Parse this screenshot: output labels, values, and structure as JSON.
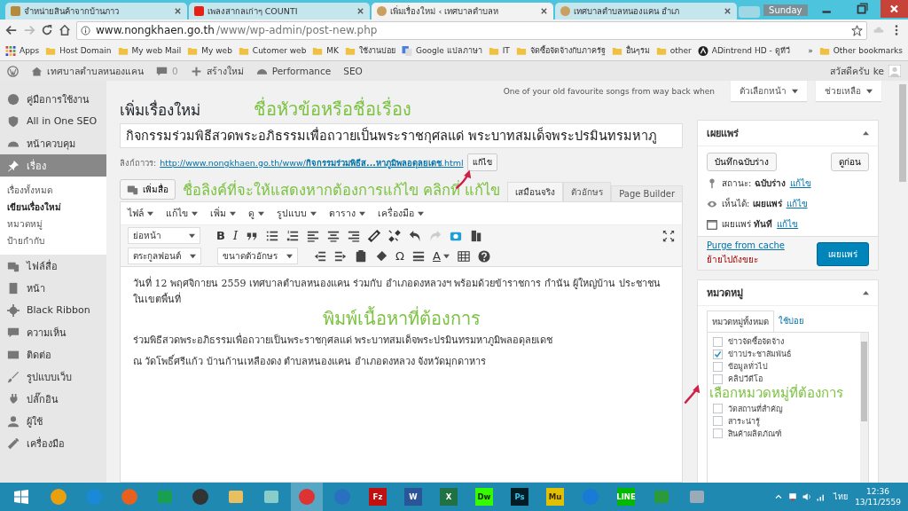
{
  "browser": {
    "tabs": [
      {
        "title": "จำหน่ายสินค้าจากบ้านภาว",
        "kind": "shop",
        "selected": false
      },
      {
        "title": "เพลงสากลเก่าๆ COUNTI",
        "kind": "video",
        "selected": false
      },
      {
        "title": "เพิ่มเรื่องใหม่ ‹ เทศบาลตำบลห",
        "kind": "site",
        "selected": true
      },
      {
        "title": "เทศบาลตำบลหนองแคน อำเภ",
        "kind": "site",
        "selected": false
      }
    ],
    "profile": "Sunday",
    "url_host": "www.nongkhaen.go.th",
    "url_path": "/www/wp-admin/post-new.php",
    "bookmarks": [
      {
        "label": "Apps",
        "kind": "apps"
      },
      {
        "label": "Host Domain",
        "kind": "folder"
      },
      {
        "label": "My web Mail",
        "kind": "folder"
      },
      {
        "label": "My web",
        "kind": "folder"
      },
      {
        "label": "Cutomer web",
        "kind": "folder"
      },
      {
        "label": "MK",
        "kind": "folder"
      },
      {
        "label": "ใช้งานบ่อย",
        "kind": "folder"
      },
      {
        "label": "Google แปลภาษา",
        "kind": "translate"
      },
      {
        "label": "IT",
        "kind": "folder"
      },
      {
        "label": "จัดซื้อจัดจ้างกับภาครัฐ",
        "kind": "folder"
      },
      {
        "label": "อื่นๆรม",
        "kind": "folder"
      },
      {
        "label": "other",
        "kind": "folder"
      },
      {
        "label": "ADintrend HD - ดูทีวี",
        "kind": "circle"
      }
    ],
    "more": "»",
    "other_bookmarks": "Other bookmarks"
  },
  "admin_bar": {
    "site": "เทศบาลตำบลหนองแคน",
    "comments": "0",
    "new": "สร้างใหม่",
    "items": [
      "Performance",
      "SEO"
    ],
    "greeting": "สวัสดีครับ ke"
  },
  "sidebar": {
    "items": [
      {
        "label": "คู่มือการใช้งาน",
        "kind": "help",
        "selected": false
      },
      {
        "label": "All in One SEO",
        "kind": "shield",
        "selected": false
      },
      {
        "label": "หน้าควบคุม",
        "kind": "gauge",
        "selected": false
      },
      {
        "label": "เรื่อง",
        "kind": "pin",
        "selected": true,
        "submenu": [
          {
            "label": "เรื่องทั้งหมด",
            "selected": false
          },
          {
            "label": "เขียนเรื่องใหม่",
            "selected": true
          },
          {
            "label": "หมวดหมู่",
            "selected": false
          },
          {
            "label": "ป้ายกำกับ",
            "selected": false
          }
        ]
      },
      {
        "label": "ไฟล์สื่อ",
        "kind": "media",
        "selected": false
      },
      {
        "label": "หน้า",
        "kind": "page",
        "selected": false
      },
      {
        "label": "Black Ribbon",
        "kind": "gear",
        "selected": false
      },
      {
        "label": "ความเห็น",
        "kind": "comment",
        "selected": false
      },
      {
        "label": "ติดต่อ",
        "kind": "mail",
        "selected": false
      },
      {
        "label": "รูปแบบเว็บ",
        "kind": "brush",
        "selected": false
      },
      {
        "label": "ปลั๊กอิน",
        "kind": "plug",
        "selected": false
      },
      {
        "label": "ผู้ใช้",
        "kind": "user",
        "selected": false
      },
      {
        "label": "เครื่องมือ",
        "kind": "wrench",
        "selected": false
      }
    ]
  },
  "screen_meta": {
    "message": "One of your old favourite songs from way back when",
    "buttons": [
      "ตัวเลือกหน้า",
      "ช่วยเหลือ"
    ]
  },
  "heading": "เพิ่มเรื่องใหม่",
  "post_title": "กิจกรรมร่วมพิธีสวดพระอภิธรรมเพื่อถวายเป็นพระราชกุศลแด่ พระบาทสมเด็จพระปรมินทรมหาภู",
  "permalink": {
    "label": "ลิงก์ถาวร:",
    "url_base": "http://www.nongkhaen.go.th/www/",
    "slug": "กิจกรรมร่วมพิธีส...หาภูมิพลอดุลยเดช",
    "ext": ".html",
    "edit": "แก้ไข"
  },
  "add_media": "เพิ่มสื่อ",
  "editor_tabs": [
    {
      "label": "เสมือนจริง",
      "selected": true
    },
    {
      "label": "ตัวอักษร",
      "selected": false
    },
    {
      "label": "Page Builder",
      "selected": false
    }
  ],
  "menubar": [
    "ไฟล์",
    "แก้ไข",
    "เพิ่ม",
    "ดู",
    "รูปแบบ",
    "ตาราง",
    "เครื่องมือ"
  ],
  "toolbar_rows": [
    [
      {
        "kind": "select",
        "label": "ย่อหน้า"
      },
      {
        "kind": "bold",
        "label": "B"
      },
      {
        "kind": "italic",
        "label": "I"
      },
      {
        "kind": "quote"
      },
      {
        "kind": "bullets"
      },
      {
        "kind": "numbers"
      },
      {
        "kind": "alignleft"
      },
      {
        "kind": "aligncenter"
      },
      {
        "kind": "alignright"
      },
      {
        "kind": "link"
      },
      {
        "kind": "unlink"
      },
      {
        "kind": "undo"
      },
      {
        "kind": "redo"
      },
      {
        "kind": "camera"
      },
      {
        "kind": "puzzle"
      },
      {
        "kind": "fullscreen"
      }
    ],
    [
      {
        "kind": "select",
        "label": "ตระกูลฟอนต์"
      },
      {
        "kind": "select",
        "label": "ขนาดตัวอักษร"
      },
      {
        "kind": "outdent"
      },
      {
        "kind": "indent"
      },
      {
        "kind": "paste"
      },
      {
        "kind": "eraser"
      },
      {
        "kind": "omega",
        "label": "Ω"
      },
      {
        "kind": "rule"
      },
      {
        "kind": "color",
        "label": "A"
      },
      {
        "kind": "table"
      },
      {
        "kind": "help"
      }
    ]
  ],
  "body": [
    "วันที่ 12 พฤศจิกายน 2559 เทศบาลตำบลหนองแคน ร่วมกับ อำเภอดงหลวงฯ พร้อมด้วยข้าราชการ กำนัน ผู้ใหญ่บ้าน ประชาชนในเขตพื้นที่",
    "ร่วมพิธีสวดพระอภิธรรมเพื่อถวายเป็นพระราชกุศลแด่ พระบาทสมเด็จพระปรมินทรมหาภูมิพลอดุลยเดช",
    "ณ วัดโพธิ์ศรีแก้ว บ้านก้านเหลืองดง ตำบลหนองแคน อำเภอดงหลวง จังหวัดมุกดาหาร"
  ],
  "publish": {
    "title": "เผยแพร่",
    "save_draft": "บันทึกฉบับร่าง",
    "preview": "ดูก่อน",
    "rows": [
      {
        "kind": "status",
        "label": "สถานะ:",
        "value": "ฉบับร่าง",
        "edit": "แก้ไข"
      },
      {
        "kind": "visibility",
        "label": "เห็นได้:",
        "value": "เผยแพร่",
        "edit": "แก้ไข"
      },
      {
        "kind": "schedule",
        "label": "เผยแพร่",
        "value": "ทันที",
        "edit": "แก้ไข"
      }
    ],
    "purge": "Purge from cache",
    "trash": "ย้ายไปถังขยะ",
    "publish": "เผยแพร่"
  },
  "categories": {
    "title": "หมวดหมู่",
    "tabs": [
      {
        "label": "หมวดหมู่ทั้งหมด",
        "selected": true
      },
      {
        "label": "ใช้บ่อย",
        "selected": false
      }
    ],
    "items": [
      {
        "label": "ข่าวจัดซื้อจัดจ้าง",
        "checked": false
      },
      {
        "label": "ข่าวประชาสัมพันธ์",
        "checked": true
      },
      {
        "label": "ข้อมูลทั่วไป",
        "checked": false
      },
      {
        "label": "คลิปวีดีโอ",
        "checked": false
      },
      {
        "label": "วัดสถานที่สำคัญ",
        "checked": false
      },
      {
        "label": "สาระน่ารู้",
        "checked": false
      },
      {
        "label": "สินค้าผลิตภัณฑ์",
        "checked": false
      }
    ]
  },
  "annotations": [
    "ชื่อหัวข้อหรือชื่อเรื่อง",
    "ชื่อลิงค์ที่จะให้แสดงหากต้องการแก้ไข คลิกที่ แก้ไข",
    "พิมพ์เนื้อหาที่ต้องการ",
    "เลือกหมวดหมู่ที่ต้องการ"
  ],
  "taskbar": {
    "apps": [
      {
        "kind": "avast",
        "selected": false
      },
      {
        "kind": "ie",
        "selected": false
      },
      {
        "kind": "firefox",
        "selected": false
      },
      {
        "kind": "store",
        "selected": false
      },
      {
        "kind": "cube",
        "selected": false
      },
      {
        "kind": "folder",
        "selected": false
      },
      {
        "kind": "notepad",
        "selected": false
      },
      {
        "kind": "chrome",
        "selected": true
      },
      {
        "kind": "bird",
        "selected": false
      },
      {
        "kind": "tile",
        "label": "Fz",
        "selected": false
      },
      {
        "kind": "tile",
        "label": "W",
        "selected": false
      },
      {
        "kind": "tile",
        "label": "X",
        "selected": false
      },
      {
        "kind": "tile",
        "label": "Dw",
        "selected": false
      },
      {
        "kind": "tile",
        "label": "Ps",
        "selected": false
      },
      {
        "kind": "tile",
        "label": "Mu",
        "selected": false
      },
      {
        "kind": "remote",
        "selected": false
      },
      {
        "kind": "tile",
        "label": "LINE",
        "selected": false
      },
      {
        "kind": "calc",
        "selected": false
      },
      {
        "kind": "monitor",
        "selected": false
      }
    ],
    "language": "ไทย",
    "time": "12:36",
    "date": "13/11/2559"
  }
}
